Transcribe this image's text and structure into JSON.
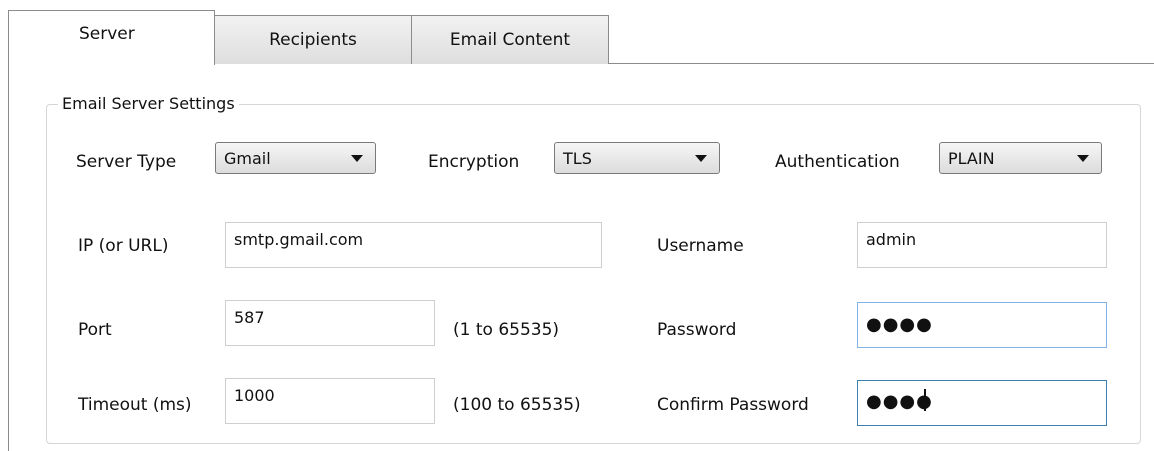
{
  "tabs": {
    "server": "Server",
    "recipients": "Recipients",
    "email_content": "Email Content"
  },
  "group": {
    "title": "Email Server Settings"
  },
  "server_type": {
    "label": "Server Type",
    "value": "Gmail"
  },
  "encryption": {
    "label": "Encryption",
    "value": "TLS"
  },
  "authentication": {
    "label": "Authentication",
    "value": "PLAIN"
  },
  "ip": {
    "label": "IP (or URL)",
    "value": "smtp.gmail.com"
  },
  "port": {
    "label": "Port",
    "value": "587",
    "range": "(1 to 65535)"
  },
  "timeout": {
    "label": "Timeout (ms)",
    "value": "1000",
    "range": "(100 to 65535)"
  },
  "username": {
    "label": "Username",
    "value": "admin"
  },
  "password": {
    "label": "Password",
    "masked": "●●●●"
  },
  "confirm_password": {
    "label": "Confirm Password",
    "masked": "●●●●"
  }
}
